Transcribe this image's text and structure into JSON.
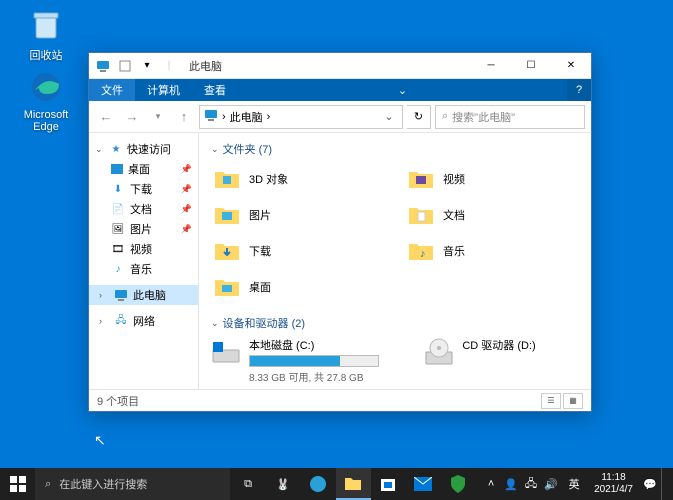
{
  "desktop": {
    "recycle": "回收站",
    "edge": "Microsoft Edge"
  },
  "explorer": {
    "title": "此电脑",
    "menu": {
      "file": "文件",
      "computer": "计算机",
      "view": "查看"
    },
    "nav": {
      "location": "此电脑",
      "sep": "›",
      "search_placeholder": "搜索\"此电脑\""
    },
    "sidebar": {
      "quick": "快速访问",
      "items": [
        {
          "label": "桌面",
          "pinned": true
        },
        {
          "label": "下载",
          "pinned": true
        },
        {
          "label": "文档",
          "pinned": true
        },
        {
          "label": "图片",
          "pinned": true
        },
        {
          "label": "视频",
          "pinned": false
        },
        {
          "label": "音乐",
          "pinned": false
        }
      ],
      "thispc": "此电脑",
      "network": "网络"
    },
    "sections": {
      "folders_title": "文件夹 (7)",
      "folders": [
        {
          "label": "3D 对象"
        },
        {
          "label": "视频"
        },
        {
          "label": "图片"
        },
        {
          "label": "文档"
        },
        {
          "label": "下载"
        },
        {
          "label": "音乐"
        },
        {
          "label": "桌面"
        }
      ],
      "drives_title": "设备和驱动器 (2)",
      "drives": [
        {
          "label": "本地磁盘 (C:)",
          "used_pct": 70,
          "sub": "8.33 GB 可用, 共 27.8 GB"
        },
        {
          "label": "CD 驱动器 (D:)"
        }
      ]
    },
    "status": "9 个项目"
  },
  "taskbar": {
    "search": "在此键入进行搜索",
    "ime": "英",
    "time": "11:18",
    "date": "2021/4/7"
  }
}
